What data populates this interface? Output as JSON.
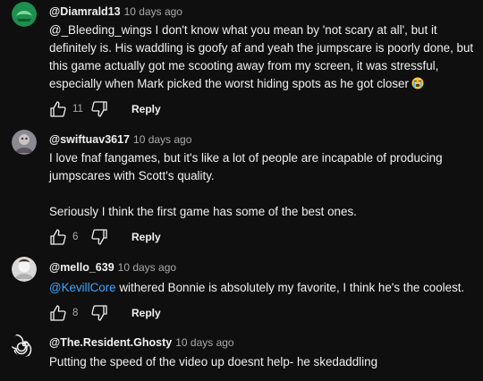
{
  "comments": [
    {
      "author": "@Diamrald13",
      "time": "10 days ago",
      "lines": [
        "@_Bleeding_wings I don't know what you mean by 'not scary at all', but it",
        "definitely is. His waddling is goofy af and yeah the jumpscare is poorly done, but",
        "this game actually got me scooting away from my screen, it was stressful,",
        "especially when Mark picked the worst hiding spots as he got closer"
      ],
      "emoji": "loudly-crying-face-emoji",
      "likes": "11",
      "reply_label": "Reply"
    },
    {
      "author": "@swiftuav3617",
      "time": "10 days ago",
      "lines": [
        "I love fnaf fangames, but it's like a lot of people are incapable of producing",
        "jumpscares with Scott's quality.",
        "",
        "Seriously I think the first game has some of the best ones."
      ],
      "likes": "6",
      "reply_label": "Reply"
    },
    {
      "author": "@mello_639",
      "time": "10 days ago",
      "mention": "@KevillCore",
      "text_after_mention": " withered Bonnie is absolutely my favorite, I think he's the coolest.",
      "likes": "8",
      "reply_label": "Reply"
    },
    {
      "author": "@The.Resident.Ghosty",
      "time": "10 days ago",
      "lines": [
        "Putting the speed of the video up doesnt help- he skedaddling"
      ]
    }
  ],
  "colors": {
    "background": "#0f0f0f",
    "text": "#f1f1f1",
    "secondary": "#aaaaaa",
    "mention": "#3ea6ff"
  }
}
